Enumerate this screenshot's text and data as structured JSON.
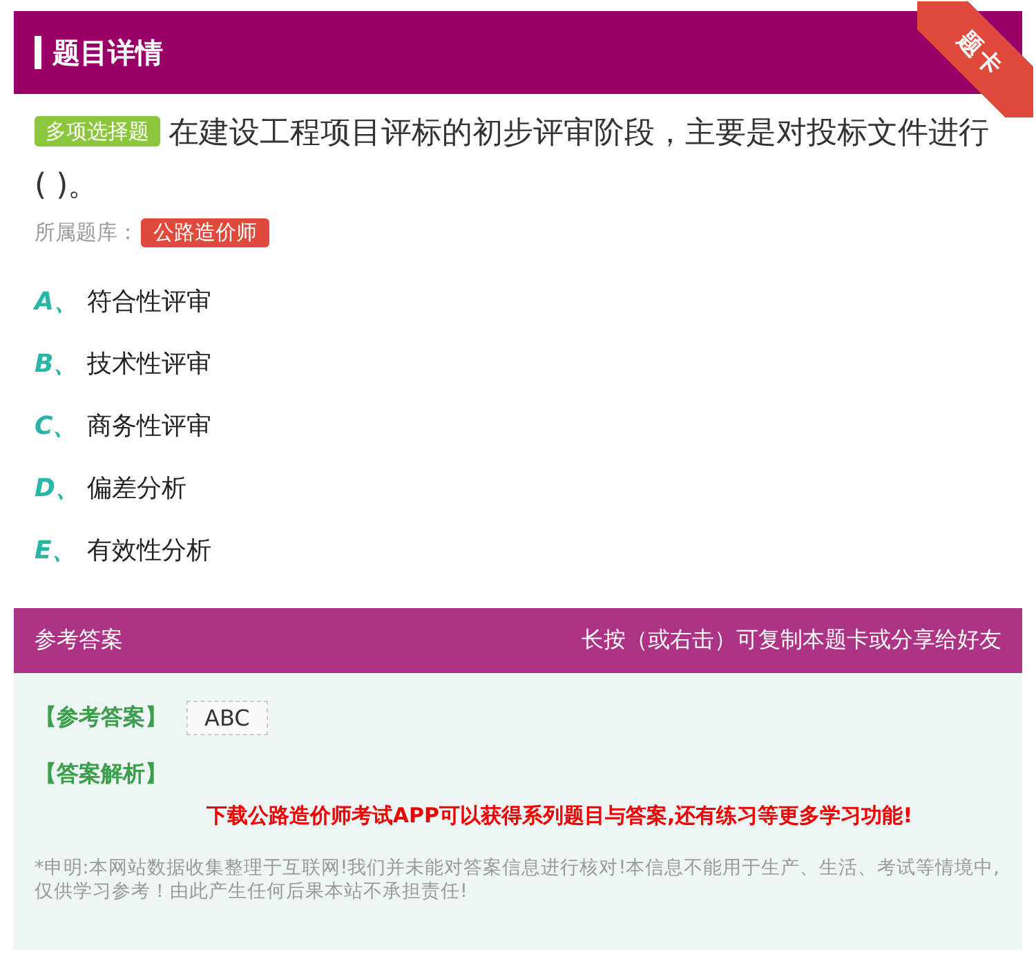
{
  "header": {
    "title": "题目详情",
    "ribbon": "题卡"
  },
  "question": {
    "type_badge": "多项选择题",
    "text": "在建设工程项目评标的初步评审阶段，主要是对投标文件进行 ( )。",
    "bank_label": "所属题库：",
    "bank": "公路造价师"
  },
  "options": [
    {
      "letter": "A、",
      "text": "符合性评审"
    },
    {
      "letter": "B、",
      "text": "技术性评审"
    },
    {
      "letter": "C、",
      "text": "商务性评审"
    },
    {
      "letter": "D、",
      "text": "偏差分析"
    },
    {
      "letter": "E、",
      "text": "有效性分析"
    }
  ],
  "answer_bar": {
    "title": "参考答案",
    "hint": "长按（或右击）可复制本题卡或分享给好友"
  },
  "answer": {
    "label": "【参考答案】",
    "value": "ABC",
    "analysis_label": "【答案解析】",
    "promo": "下载公路造价师考试APP可以获得系列题目与答案,还有练习等更多学习功能!",
    "disclaimer": "*申明:本网站数据收集整理于互联网!我们并未能对答案信息进行核对!本信息不能用于生产、生活、考试等情境中,仅供学习参考！由此产生任何后果本站不承担责任!"
  }
}
